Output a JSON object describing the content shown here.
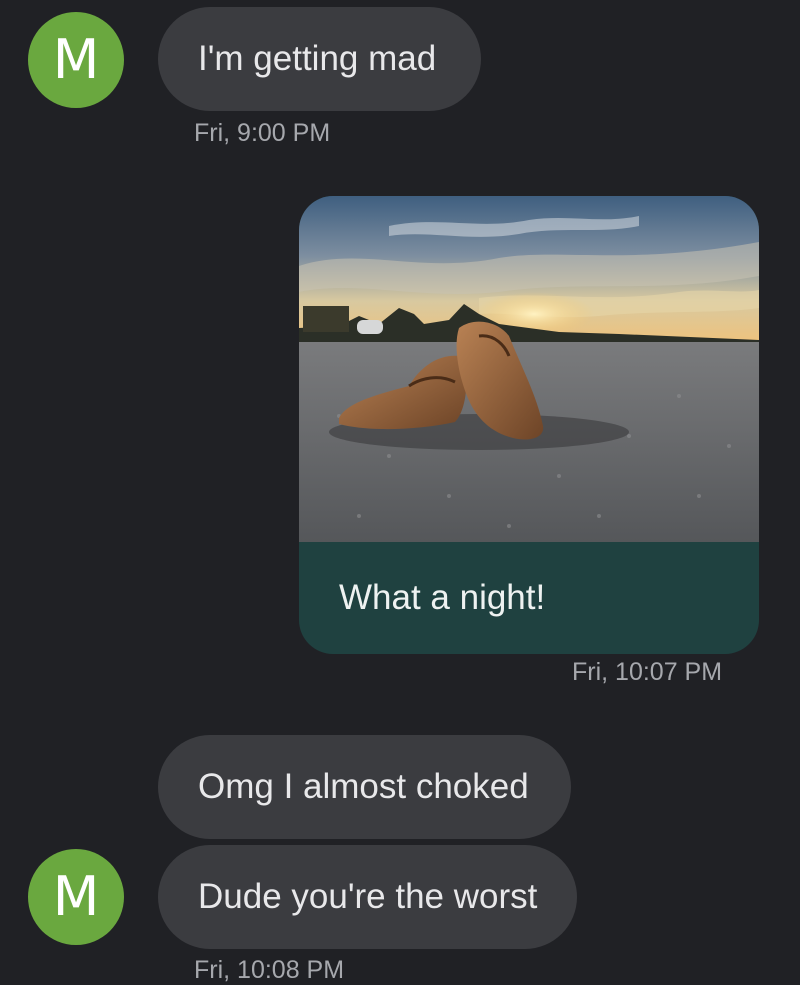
{
  "contact": {
    "avatar_initial": "M",
    "avatar_color": "#6aa83f"
  },
  "messages": [
    {
      "direction": "incoming",
      "text": "I'm getting mad",
      "timestamp": "Fri, 9:00 PM"
    },
    {
      "direction": "outgoing",
      "attachment_icon": "photo-shoes-sunset",
      "text": "What a night!",
      "timestamp": "Fri, 10:07 PM"
    },
    {
      "direction": "incoming",
      "text": "Omg I almost choked"
    },
    {
      "direction": "incoming",
      "text": "Dude you're the worst",
      "timestamp": "Fri, 10:08 PM"
    }
  ],
  "colors": {
    "background": "#202125",
    "incoming_bubble": "#3b3c40",
    "outgoing_bubble": "#1f4140",
    "timestamp_text": "#a6a8ad"
  }
}
